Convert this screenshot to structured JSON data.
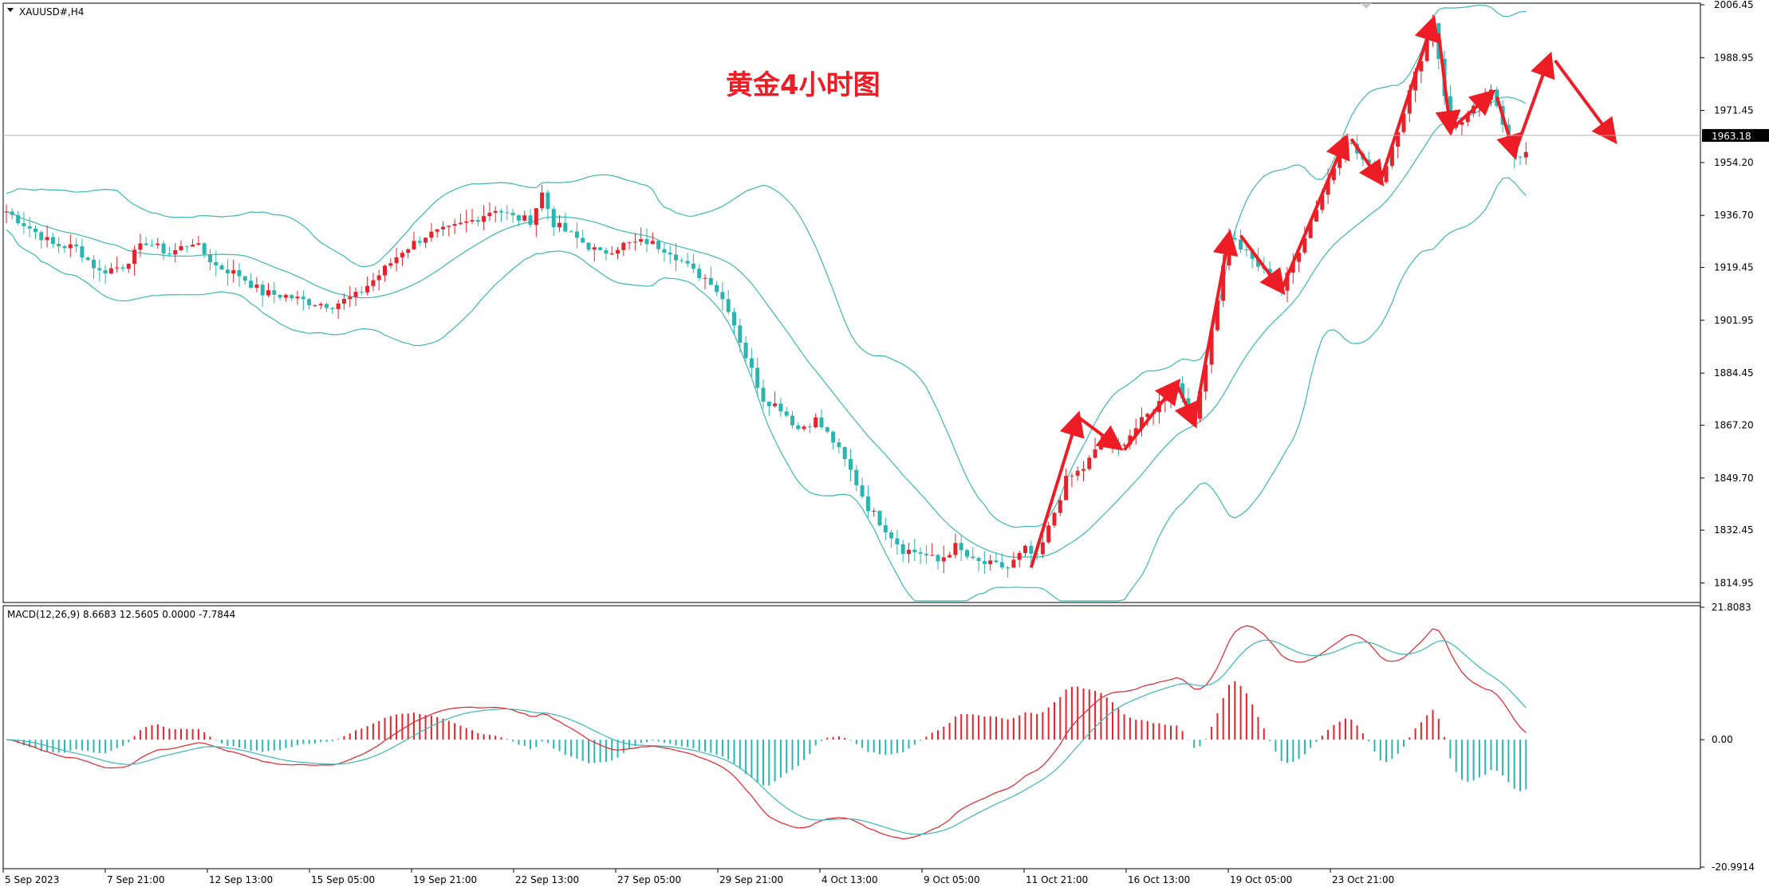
{
  "window": {
    "symbol_label": "XAUUSD#,H4",
    "annotation_title": "黄金4小时图",
    "indicator_label": "MACD(12,26,9) 8.6683 12.5605 0.0000 -7.7844"
  },
  "colors": {
    "background": "#ffffff",
    "bull_candle": "#e8222c",
    "bear_candle": "#2bb5b0",
    "band_line": "#3cb8b4",
    "annotation_red": "#ee1c24",
    "axis_text": "#000000",
    "current_price_bg": "#000000"
  },
  "chart_data": [
    {
      "type": "candlestick",
      "title": "",
      "symbol": "XAUUSD#",
      "timeframe": "H4",
      "y_ticks": [
        "2006.45",
        "1988.95",
        "1971.45",
        "1954.20",
        "1936.70",
        "1919.45",
        "1901.95",
        "1884.45",
        "1867.20",
        "1849.70",
        "1832.45",
        "1814.95"
      ],
      "ylim": [
        1809,
        2006.45
      ],
      "current_price": "1963.18",
      "x_ticks": [
        "5 Sep 2023",
        "7 Sep 21:00",
        "12 Sep 13:00",
        "15 Sep 05:00",
        "19 Sep 21:00",
        "22 Sep 13:00",
        "27 Sep 05:00",
        "29 Sep 21:00",
        "4 Oct 13:00",
        "9 Oct 05:00",
        "11 Oct 21:00",
        "16 Oct 13:00",
        "19 Oct 05:00",
        "23 Oct 21:00"
      ],
      "bars_total": 190,
      "close_anchors": [
        [
          0,
          1938
        ],
        [
          8,
          1927
        ],
        [
          12,
          1926
        ],
        [
          16,
          1918
        ],
        [
          20,
          1920
        ],
        [
          24,
          1928
        ],
        [
          28,
          1924
        ],
        [
          32,
          1928
        ],
        [
          36,
          1920
        ],
        [
          40,
          1917
        ],
        [
          44,
          1911
        ],
        [
          48,
          1910
        ],
        [
          52,
          1908
        ],
        [
          56,
          1907
        ],
        [
          60,
          1910
        ],
        [
          64,
          1917
        ],
        [
          68,
          1925
        ],
        [
          72,
          1930
        ],
        [
          76,
          1932
        ],
        [
          80,
          1935
        ],
        [
          84,
          1939
        ],
        [
          87,
          1936
        ],
        [
          90,
          1935
        ],
        [
          92,
          1944
        ],
        [
          94,
          1934
        ],
        [
          98,
          1929
        ],
        [
          102,
          1924
        ],
        [
          106,
          1927
        ],
        [
          110,
          1928
        ],
        [
          114,
          1925
        ],
        [
          118,
          1918
        ],
        [
          121,
          1915
        ],
        [
          124,
          1906
        ],
        [
          127,
          1890
        ],
        [
          130,
          1876
        ],
        [
          133,
          1873
        ],
        [
          136,
          1866
        ],
        [
          139,
          1869
        ],
        [
          142,
          1862
        ],
        [
          145,
          1852
        ],
        [
          148,
          1840
        ],
        [
          151,
          1833
        ],
        [
          154,
          1826
        ],
        [
          157,
          1825
        ],
        [
          160,
          1822
        ],
        [
          163,
          1827
        ],
        [
          166,
          1822
        ],
        [
          169,
          1821
        ],
        [
          172,
          1820
        ],
        [
          175,
          1826
        ],
        [
          177,
          1823
        ],
        [
          179,
          1833
        ],
        [
          182,
          1849
        ],
        [
          185,
          1853
        ],
        [
          188,
          1861
        ]
      ],
      "band_anchors_note": "Bollinger-style envelope drawn around price",
      "annotation_arrows": [
        {
          "from_bar": 176,
          "from": 1820,
          "to_bar": 184,
          "to": 1870
        },
        {
          "from_bar": 184,
          "from": 1870,
          "to_bar": 191,
          "to": 1860
        },
        {
          "from_bar": 192,
          "from": 1859,
          "to_bar": 201,
          "to": 1881
        },
        {
          "from_bar": 201,
          "from": 1881,
          "to_bar": 204,
          "to": 1868
        },
        {
          "from_bar": 204,
          "from": 1868,
          "to_bar": 210,
          "to": 1930
        },
        {
          "from_bar": 212,
          "from": 1930,
          "to_bar": 219,
          "to": 1912
        },
        {
          "from_bar": 219,
          "from": 1912,
          "to_bar": 230,
          "to": 1962
        },
        {
          "from_bar": 231,
          "from": 1962,
          "to_bar": 236,
          "to": 1948
        },
        {
          "from_bar": 236,
          "from": 1948,
          "to_bar": 245,
          "to": 2001
        },
        {
          "from_bar": 246,
          "from": 1997,
          "to_bar": 248,
          "to": 1965
        },
        {
          "from_bar": 248,
          "from": 1965,
          "to_bar": 255,
          "to": 1977
        },
        {
          "from_bar": 256,
          "from": 1976,
          "to_bar": 259,
          "to": 1957
        },
        {
          "from_bar": 259,
          "from": 1957,
          "to_bar": 265,
          "to": 1989
        },
        {
          "from_bar": 266,
          "from": 1988,
          "to_bar": 276,
          "to": 1962
        }
      ]
    },
    {
      "type": "macd",
      "title": "MACD(12,26,9)",
      "values": {
        "macd": 8.6683,
        "signal": 12.5605,
        "level": 0.0,
        "histogram": -7.7844
      },
      "y_ticks": [
        "21.8083",
        "0.00",
        "-20.9914"
      ],
      "ylim": [
        -20.9914,
        21.8083
      ],
      "histogram_anchors": [
        [
          0,
          -4
        ],
        [
          10,
          -3
        ],
        [
          14,
          0
        ],
        [
          18,
          1
        ],
        [
          22,
          1
        ],
        [
          26,
          0
        ],
        [
          30,
          -1
        ],
        [
          36,
          -1
        ],
        [
          40,
          0
        ],
        [
          46,
          3
        ],
        [
          52,
          2
        ],
        [
          56,
          0
        ],
        [
          58,
          -3
        ],
        [
          62,
          -4
        ],
        [
          66,
          -2
        ],
        [
          70,
          -1
        ],
        [
          74,
          0
        ],
        [
          78,
          -2
        ],
        [
          82,
          -4
        ],
        [
          86,
          -3
        ],
        [
          88,
          0
        ],
        [
          90,
          -1
        ],
        [
          94,
          -4
        ],
        [
          98,
          -3
        ],
        [
          102,
          1
        ],
        [
          106,
          3
        ],
        [
          110,
          3
        ],
        [
          114,
          5
        ],
        [
          118,
          7
        ],
        [
          121,
          6
        ],
        [
          124,
          3
        ],
        [
          126,
          1
        ],
        [
          128,
          -1
        ],
        [
          130,
          -3
        ],
        [
          132,
          -4
        ],
        [
          134,
          -3
        ],
        [
          136,
          -1
        ],
        [
          138,
          0
        ],
        [
          140,
          2
        ],
        [
          142,
          4
        ],
        [
          144,
          6
        ],
        [
          146,
          7
        ],
        [
          148,
          6
        ],
        [
          150,
          4
        ],
        [
          152,
          2
        ],
        [
          154,
          1
        ],
        [
          156,
          0
        ],
        [
          158,
          -1
        ],
        [
          160,
          -2
        ],
        [
          162,
          -3
        ],
        [
          164,
          -4
        ],
        [
          166,
          -3
        ],
        [
          168,
          -2
        ]
      ]
    }
  ]
}
